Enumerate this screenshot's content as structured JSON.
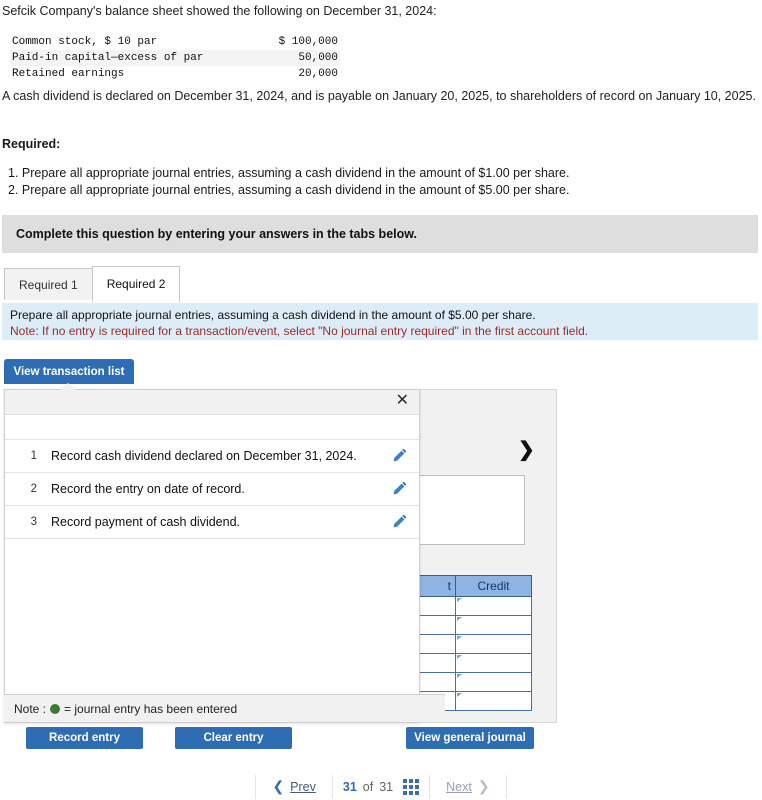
{
  "question": {
    "intro": "Sefcik Company's balance sheet showed the following on December 31, 2024:",
    "balance_sheet": [
      {
        "label": "Common stock, $ 10 par",
        "amount": "$ 100,000"
      },
      {
        "label": "Paid-in capital—excess of par",
        "amount": "50,000"
      },
      {
        "label": "Retained earnings",
        "amount": "20,000"
      }
    ],
    "paragraph": "A cash dividend is declared on December 31, 2024, and is payable on January 20, 2025, to shareholders of record on January 10, 2025.",
    "required_heading": "Required:",
    "required_items": [
      "1. Prepare all appropriate journal entries, assuming a cash dividend in the amount of $1.00 per share.",
      "2. Prepare all appropriate journal entries, assuming a cash dividend in the amount of $5.00 per share."
    ]
  },
  "complete_bar": {
    "text": "Complete this question by entering your answers in the tabs below."
  },
  "tabs": [
    {
      "label": "Required 1",
      "active": false
    },
    {
      "label": "Required 2",
      "active": true
    }
  ],
  "info": {
    "line1": "Prepare all appropriate journal entries, assuming a cash dividend in the amount of $5.00 per share.",
    "line2": "Note: If no entry is required for a transaction/event, select \"No journal entry required\" in the first account field."
  },
  "toolbar": {
    "view_transaction_list": "View transaction list"
  },
  "popup": {
    "close_icon": "close-icon",
    "transactions": [
      {
        "num": "1",
        "desc": "Record cash dividend declared on December 31, 2024.",
        "edit_icon": "pencil-icon"
      },
      {
        "num": "2",
        "desc": "Record the entry on date of record.",
        "edit_icon": "pencil-icon"
      },
      {
        "num": "3",
        "desc": "Record payment of cash dividend.",
        "edit_icon": "pencil-icon"
      }
    ]
  },
  "journal": {
    "headers": [
      "t",
      "Credit"
    ],
    "row_count": 6,
    "header_bg": "#8db4e2",
    "next_icon": "chevron-right-icon"
  },
  "note": {
    "prefix": "Note :",
    "text": "= journal entry has been entered",
    "dot_color": "#3f7a34"
  },
  "actions": {
    "record_entry": "Record entry",
    "clear_entry": "Clear entry",
    "view_general_journal": "View general journal"
  },
  "footer": {
    "prev": "Prev",
    "next": "Next",
    "current": "31",
    "of": "of",
    "total": "31",
    "grid_icon": "grid-icon"
  }
}
